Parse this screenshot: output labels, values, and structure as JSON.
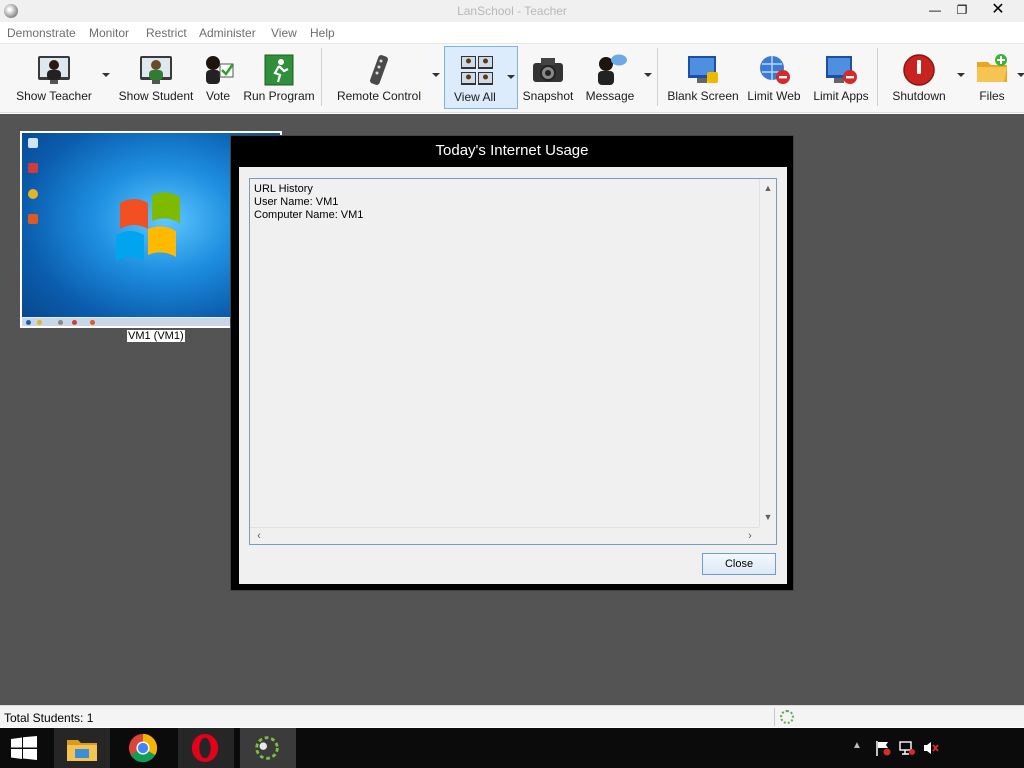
{
  "window": {
    "title": "LanSchool - Teacher"
  },
  "menu": [
    "Demonstrate",
    "Monitor",
    "Restrict",
    "Administer",
    "View",
    "Help"
  ],
  "toolbar": {
    "show_teacher": "Show Teacher",
    "show_student": "Show Student",
    "vote": "Vote",
    "run_program": "Run Program",
    "remote_control": "Remote Control",
    "view_all": "View All",
    "snapshot": "Snapshot",
    "message": "Message",
    "blank_screen": "Blank Screen",
    "limit_web": "Limit Web",
    "limit_apps": "Limit Apps",
    "shutdown": "Shutdown",
    "files": "Files"
  },
  "student": {
    "label": "VM1 (VM1)"
  },
  "dialog": {
    "title": "Today's Internet Usage",
    "lines": [
      "URL History",
      "User Name: VM1",
      "Computer Name: VM1"
    ],
    "close_label": "Close"
  },
  "status": {
    "total_students": "Total Students: 1"
  },
  "colors": {
    "workspace_bg": "#545454",
    "dialog_frame": "#000000",
    "accent": "#7eb4ea"
  },
  "icons": {
    "taskbar": [
      "windows-start-icon",
      "file-explorer-icon",
      "chrome-icon",
      "opera-icon",
      "lanschool-icon"
    ],
    "tray": [
      "chevron-up-icon",
      "action-center-flag-icon",
      "network-icon",
      "volume-muted-icon"
    ]
  }
}
